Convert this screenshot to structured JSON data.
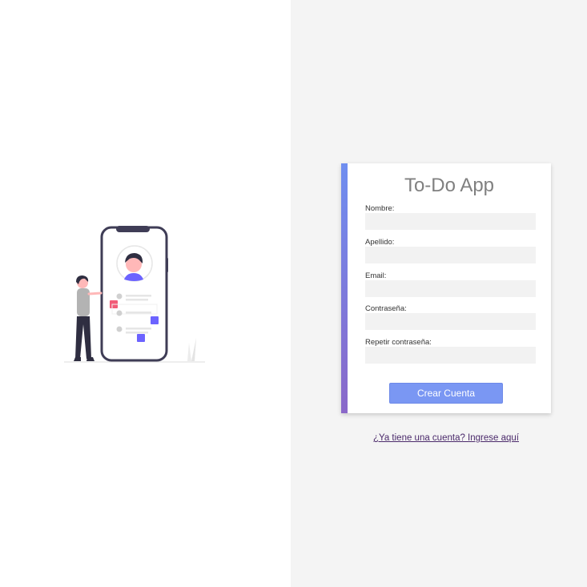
{
  "app": {
    "title": "To-Do App"
  },
  "illustration": {
    "icon": "person-with-phone-illustration"
  },
  "form": {
    "fields": [
      {
        "label": "Nombre:",
        "value": ""
      },
      {
        "label": "Apellido:",
        "value": ""
      },
      {
        "label": "Email:",
        "value": ""
      },
      {
        "label": "Contraseña:",
        "value": ""
      },
      {
        "label": "Repetir contraseña:",
        "value": ""
      }
    ],
    "submit_label": "Crear Cuenta"
  },
  "login_link": "¿Ya tiene una cuenta? Ingrese aquí",
  "colors": {
    "accent_top": "#6f8ef0",
    "accent_bottom": "#8a68c9",
    "button": "#7a97f3",
    "link": "#4b2a6b",
    "panel_bg": "#f4f4f4"
  }
}
